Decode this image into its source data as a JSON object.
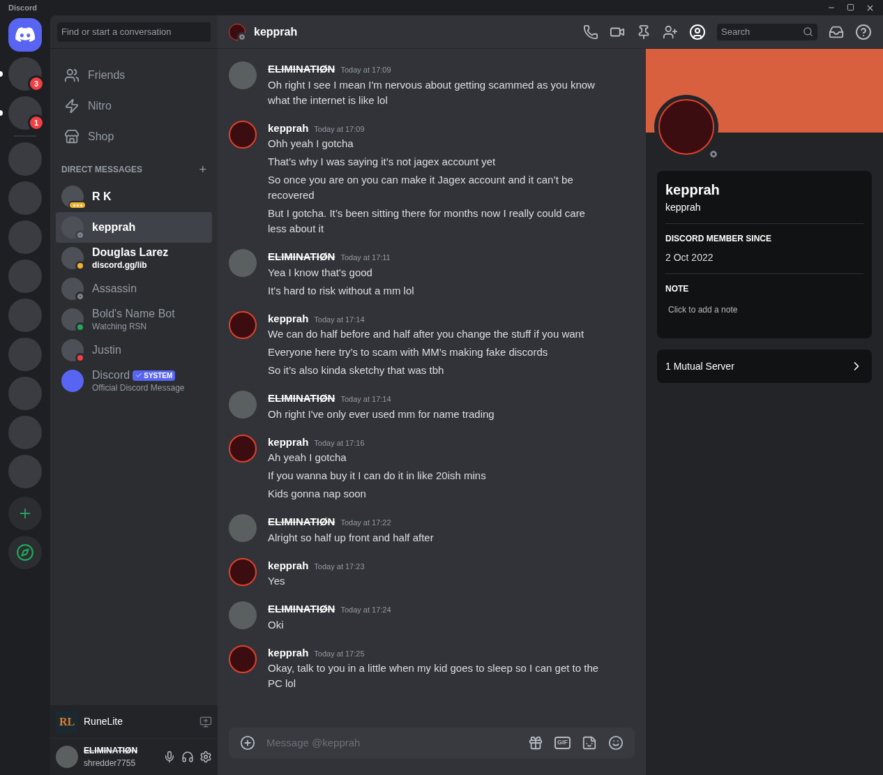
{
  "window": {
    "title": "Discord"
  },
  "servers": [
    {
      "badge": "3",
      "unread": true
    },
    {
      "badge": "1",
      "unread": true
    },
    {
      "unread": false
    },
    {
      "unread": false
    },
    {
      "unread": false
    },
    {
      "unread": false
    },
    {
      "unread": false
    },
    {
      "unread": false
    },
    {
      "unread": false
    },
    {
      "unread": false
    },
    {
      "unread": false
    }
  ],
  "search": {
    "placeholder": "Find or start a conversation"
  },
  "nav": [
    {
      "kind": "friends",
      "label": "Friends"
    },
    {
      "kind": "nitro",
      "label": "Nitro"
    },
    {
      "kind": "shop",
      "label": "Shop"
    }
  ],
  "dm_header": {
    "title": "DIRECT MESSAGES",
    "add": "+"
  },
  "dms": [
    {
      "name": "R K",
      "kind": "typing",
      "color": "#f0b232",
      "selected": false,
      "unread": true
    },
    {
      "name": "kepprah",
      "kind": "offline",
      "color": "#80848e",
      "selected": true,
      "unread": true
    },
    {
      "name": "Douglas Larez",
      "subtitle": "discord.gg/lib",
      "kind": "idle",
      "color": "#f0b232",
      "selected": false,
      "unread": true
    },
    {
      "name": "Assassin",
      "kind": "offline",
      "color": "#80848e",
      "selected": false,
      "unread": false
    },
    {
      "name": "Bold's Name Bot",
      "subtitle": "Watching RSN",
      "kind": "online",
      "color": "#23a55a",
      "selected": false,
      "unread": false
    },
    {
      "name": "Justin",
      "kind": "dnd",
      "color": "#f23f43",
      "selected": false,
      "unread": false
    },
    {
      "name": "Discord",
      "subtitle": "Official Discord Message",
      "kind": "system",
      "selected": false,
      "unread": false,
      "badge": "SYSTEM"
    }
  ],
  "activity": {
    "name": "RuneLite",
    "logo": "RL"
  },
  "user": {
    "display_name": "ELIMINATIØN",
    "username": "shredder7755",
    "muted": false
  },
  "chat": {
    "recipient": "kepprah",
    "search_placeholder": "Search",
    "message_placeholder": "Message @kepprah",
    "gif": "GIF",
    "messages": [
      {
        "author": "ELIMINATIØN",
        "kind": "self",
        "time": "Today at 17:09",
        "lines": [
          "Oh right I see I mean I'm nervous about getting scammed as you know what the internet is like lol"
        ]
      },
      {
        "author": "kepprah",
        "kind": "other",
        "time": "Today at 17:09",
        "lines": [
          "Ohh yeah I gotcha",
          "That’s why I was saying it’s not jagex account yet",
          "So once you are on you can make it Jagex account and it can’t be recovered",
          "But I gotcha. It’s been sitting there for months now I really could care less about it"
        ]
      },
      {
        "author": "ELIMINATIØN",
        "kind": "self",
        "time": "Today at 17:11",
        "lines": [
          "Yea I know that's good",
          "It's hard to risk without a mm lol"
        ]
      },
      {
        "author": "kepprah",
        "kind": "other",
        "time": "Today at 17:14",
        "lines": [
          "We can do half before and half after you change the stuff if you want",
          "Everyone here try’s to scam with MM’s making fake discords",
          "So it’s also kinda sketchy that was tbh"
        ]
      },
      {
        "author": "ELIMINATIØN",
        "kind": "self",
        "time": "Today at 17:14",
        "lines": [
          "Oh right I've only ever used mm for name trading"
        ]
      },
      {
        "author": "kepprah",
        "kind": "other",
        "time": "Today at 17:16",
        "lines": [
          "Ah yeah I gotcha",
          "If you wanna buy it I can do it in like 20ish mins",
          "Kids gonna nap soon"
        ]
      },
      {
        "author": "ELIMINATIØN",
        "kind": "self",
        "time": "Today at 17:22",
        "lines": [
          "Alright so half up front and half after"
        ]
      },
      {
        "author": "kepprah",
        "kind": "other",
        "time": "Today at 17:23",
        "lines": [
          "Yes"
        ]
      },
      {
        "author": "ELIMINATIØN",
        "kind": "self",
        "time": "Today at 17:24",
        "lines": [
          "Oki"
        ]
      },
      {
        "author": "kepprah",
        "kind": "other",
        "time": "Today at 17:25",
        "lines": [
          "Okay, talk to you in a little when my kid goes to sleep so I can get to the PC lol"
        ]
      }
    ]
  },
  "profile": {
    "status_dot": {
      "kind": "offline",
      "color": "#80848e"
    },
    "display_name": "kepprah",
    "username": "kepprah",
    "member_since_label": "DISCORD MEMBER SINCE",
    "member_since": "2 Oct 2022",
    "note_label": "NOTE",
    "note_placeholder": "Click to add a note",
    "mutual": "1 Mutual Server"
  }
}
